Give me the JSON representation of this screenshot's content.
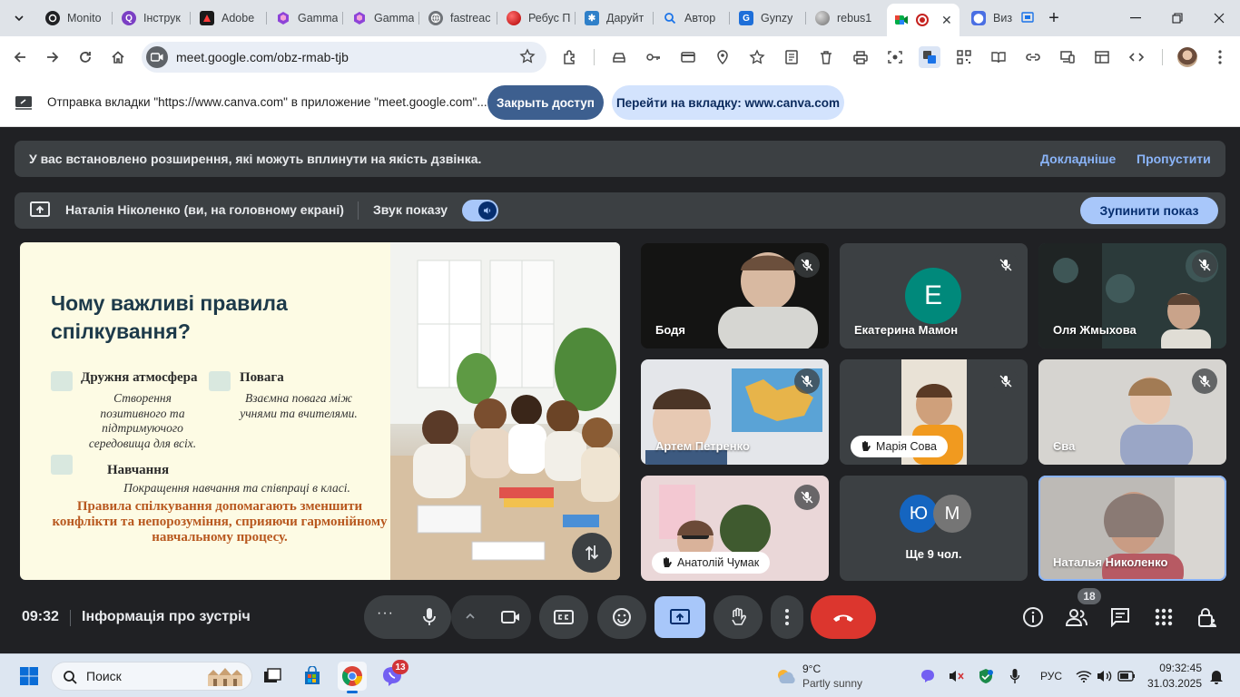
{
  "browser": {
    "tabs": [
      {
        "label": "Monito",
        "icon": "meet-icon"
      },
      {
        "label": "Інструк",
        "icon": "q-icon"
      },
      {
        "label": "Adobe",
        "icon": "adobe-icon"
      },
      {
        "label": "Gamma",
        "icon": "gamma-icon"
      },
      {
        "label": "Gamma",
        "icon": "gamma-icon"
      },
      {
        "label": "fastreac",
        "icon": "globe-icon"
      },
      {
        "label": "Ребус П",
        "icon": "ball-icon"
      },
      {
        "label": "Даруйт",
        "icon": "puzzle-icon"
      },
      {
        "label": "Автор",
        "icon": "search-icon"
      },
      {
        "label": "Gynzy",
        "icon": "gynzy-icon"
      },
      {
        "label": "rebus1",
        "icon": "sphere-icon"
      },
      {
        "label": "",
        "icon": "meet-icon"
      },
      {
        "label": "Виз",
        "icon": "viz-icon"
      }
    ],
    "new_tab": "+",
    "url": "meet.google.com/obz-rmab-tjb"
  },
  "share_bar": {
    "message": "Отправка вкладки \"https://www.canva.com\" в приложение \"meet.google.com\"...",
    "close_access_label": "Закрыть доступ",
    "goto_tab_label": "Перейти на вкладку: www.canva.com"
  },
  "meet": {
    "extension_banner": {
      "text": "У вас встановлено розширення, які можуть вплинути на якість дзвінка.",
      "learn_more": "Докладніше",
      "skip": "Пропустити"
    },
    "presenting": {
      "text": "Наталія Ніколенко (ви, на головному екрані)",
      "sound_label": "Звук показу",
      "sound_on": true,
      "stop_label": "Зупинити показ"
    },
    "slide": {
      "title": "Чому важливі правила спілкування?",
      "items": [
        {
          "heading": "Дружня атмосфера",
          "desc": "Створення позитивного та підтримуючого середовища для всіх."
        },
        {
          "heading": "Повага",
          "desc": "Взаємна повага між учнями та вчителями."
        },
        {
          "heading": "Навчання",
          "desc": "Покращення навчання та співпраці в класі."
        }
      ],
      "conclusion": "Правила спілкування допомагають зменшити конфлікти та непорозуміння, сприяючи гармонійному навчальному процесу."
    },
    "participants": [
      {
        "name": "Бодя",
        "muted": true,
        "video": true
      },
      {
        "name": "Екатерина Мамон",
        "muted": true,
        "video": false,
        "initial": "Е",
        "color": "#00897b"
      },
      {
        "name": "Оля Жмыхова",
        "muted": true,
        "video": true
      },
      {
        "name": "Артем Петренко",
        "muted": true,
        "video": true
      },
      {
        "name": "Марія Сова",
        "muted": true,
        "video": true,
        "hand_raised": true
      },
      {
        "name": "Єва",
        "muted": true,
        "video": true
      },
      {
        "name": "Анатолій Чумак",
        "muted": true,
        "video": true,
        "hand_raised": true
      },
      {
        "name": "Ще 9 чол.",
        "initials": [
          "Ю",
          "М"
        ],
        "colors": [
          "#1565c0",
          "#757575"
        ]
      },
      {
        "name": "Наталья Николенко",
        "muted": false,
        "video": true,
        "speaking": true
      }
    ],
    "controls": {
      "time": "09:32",
      "meeting_info": "Інформація про зустріч",
      "people_count": "18"
    }
  },
  "taskbar": {
    "search_placeholder": "Поиск",
    "weather_temp": "9°C",
    "weather_desc": "Partly sunny",
    "language": "РУС",
    "time": "09:32:45",
    "date": "31.03.2025",
    "notification_count": "13"
  },
  "colors": {
    "meet_bg": "#202124",
    "accent_blue": "#a8c7fa",
    "hangup_red": "#dc362e",
    "link_blue": "#8ab4f8",
    "slide_orange": "#b8581f"
  }
}
